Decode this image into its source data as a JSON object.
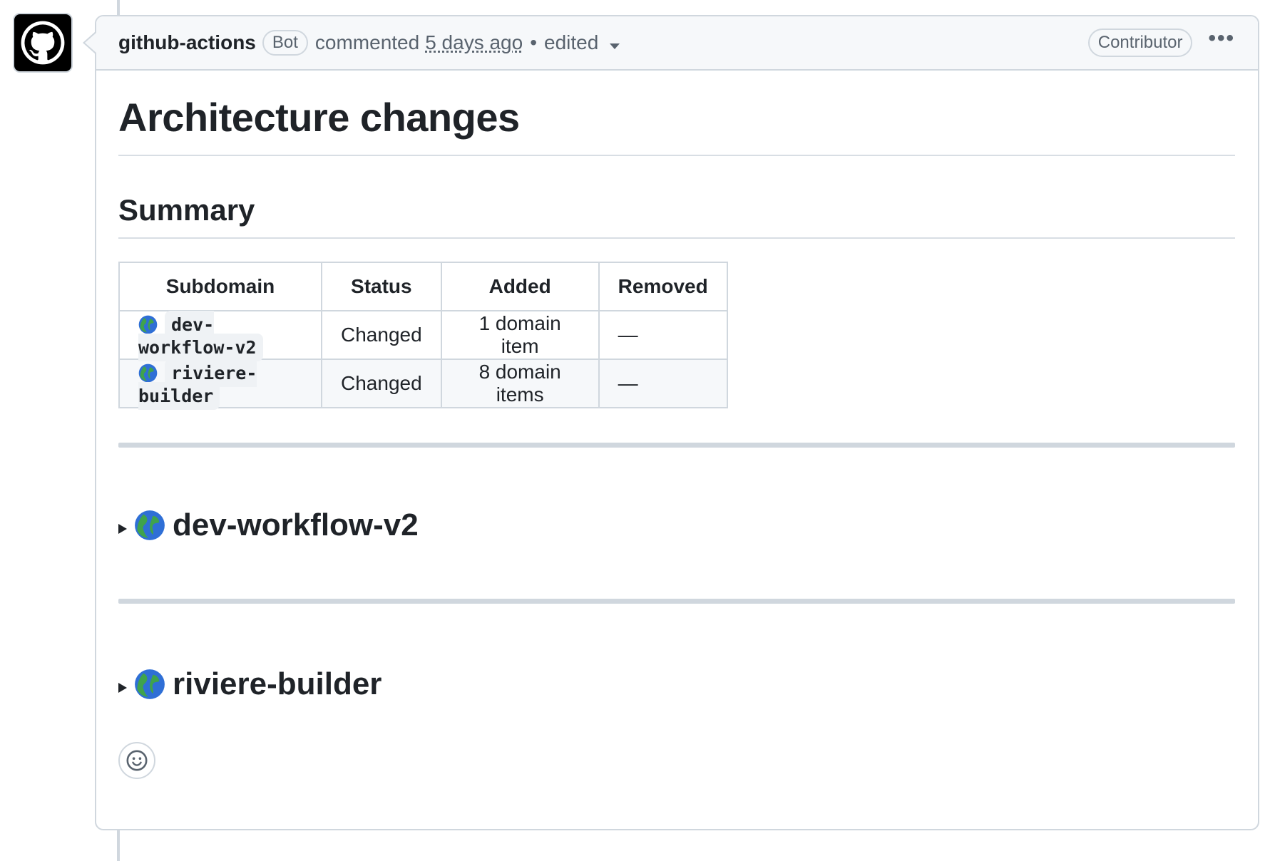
{
  "comment": {
    "author": "github-actions",
    "bot_badge": "Bot",
    "action": "commented",
    "time": "5 days ago",
    "separator": "•",
    "edited": "edited",
    "role_badge": "Contributor",
    "more_icon": "kebab-horizontal-icon",
    "avatar_icon": "github-octocat-icon"
  },
  "content": {
    "title": "Architecture changes",
    "summary_heading": "Summary",
    "table": {
      "headers": [
        "Subdomain",
        "Status",
        "Added",
        "Removed"
      ],
      "rows": [
        {
          "icon": "globe-icon",
          "subdomain": "dev-workflow-v2",
          "status": "Changed",
          "added": "1 domain item",
          "removed": "—"
        },
        {
          "icon": "globe-icon",
          "subdomain": "riviere-builder",
          "status": "Changed",
          "added": "8 domain items",
          "removed": "—"
        }
      ]
    },
    "sections": [
      {
        "icon": "globe-icon",
        "title": "dev-workflow-v2"
      },
      {
        "icon": "globe-icon",
        "title": "riviere-builder"
      }
    ],
    "reaction_icon": "smiley-icon"
  },
  "colors": {
    "border": "#d0d7de",
    "header_bg": "#f6f8fa",
    "text": "#1f2328",
    "muted": "#59636e"
  }
}
